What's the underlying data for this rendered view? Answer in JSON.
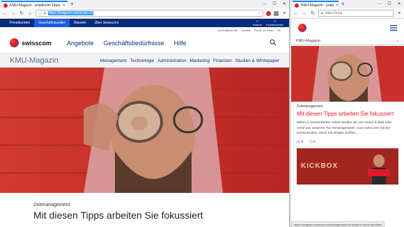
{
  "left_window": {
    "tab_title": "KMU-Magazin - praktische Tipps",
    "url_selected": "https://magazin.swisscom.ch",
    "reader_label": "☰",
    "topnav": {
      "items": [
        "Privatkunden",
        "Geschäftskunden",
        "Bluewin",
        "Über Swisscom"
      ],
      "active_index": 1,
      "right_items": [
        "Partner",
        "Kundencenter"
      ]
    },
    "utility": [
      "Geschäftskunde",
      "Kontakt",
      "Termin im Shop",
      "DE"
    ],
    "brand": "swisscom",
    "mainmenu": [
      "Angebote",
      "Geschäftsbedürfnisse",
      "Hilfe"
    ],
    "magazine_title": "KMU-Magazin",
    "magnav": [
      "Management",
      "Technologie",
      "Administration",
      "Marketing",
      "Finanzen",
      "Studien & Whitepaper"
    ],
    "article": {
      "kicker": "Zeitmanagement",
      "headline": "Mit diesen Tipps arbeiten Sie fokussiert"
    }
  },
  "right_window": {
    "tab_title": "KMU-Magazin - prakt",
    "url": "https://mag",
    "magazine_title": "KMU-Magazin",
    "article": {
      "kicker": "Zeitmanagement",
      "title": "Mit diesen Tipps arbeiten Sie fokussiert",
      "teaser": "Mitten in konzentrierter Arbeit werden wir von einem E-Mail oder Anruf aus unserem Tun herausgerissen, und vorbei ist's mit der Konzentration. Doch mit einigen Kniffen...",
      "likes": "4",
      "comments": "0"
    },
    "thumb_text": "KICKBOX",
    "status_url": "https://magazin.swisscom.ch/management/mit-arbeit-in-fokus-behalten/"
  },
  "colors": {
    "brand_navy": "#0a2c7c",
    "brand_blue": "#1e5bd8",
    "accent_red": "#e3172b",
    "browser_blue": "#0a84ff"
  }
}
